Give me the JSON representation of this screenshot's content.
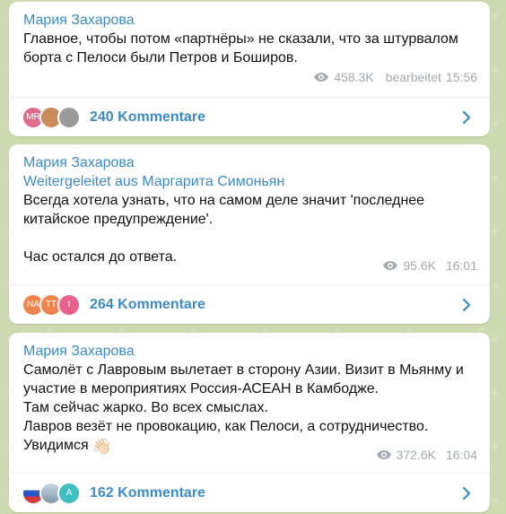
{
  "posts": [
    {
      "author": "Мария Захарова",
      "text": "Главное, чтобы потом «партнёры» не сказали, что за штурвалом борта с Пелоси были Петров и Боширов.",
      "views": "458.3K",
      "edited": "bearbeitet",
      "time": "15:56",
      "comments_label": "240 Kommentare",
      "avatars": [
        {
          "label": "MR",
          "color": "#e06b8b"
        },
        {
          "label": "",
          "color": "#c98b5a"
        },
        {
          "label": "",
          "color": "#9a9a9a"
        }
      ]
    },
    {
      "author": "Мария Захарова",
      "forwarded": "Weitergeleitet aus Маргарита Симоньян",
      "text": "Всегда хотела узнать, что на самом деле значит 'последнее китайское предупреждение'.\n\nЧас остался до ответа.",
      "views": "95.6K",
      "time": "16:01",
      "comments_label": "264 Kommentare",
      "avatars": [
        {
          "label": "NA",
          "color": "#f0844c"
        },
        {
          "label": "TT",
          "color": "#f0844c"
        },
        {
          "label": "I",
          "color": "#e8608c"
        }
      ]
    },
    {
      "author": "Мария Захарова",
      "text": "Самолёт с Лавровым вылетает в сторону Азии. Визит в Мьянму и участие в мероприятиях Россия-АСЕАН в Камбодже.\nТам сейчас жарко. Во всех смыслах.\nЛавров везёт не провокацию, как Пелоси, а сотрудничество.\nУвидимся",
      "emoji": "👋🏻",
      "views": "372.6K",
      "time": "16:04",
      "comments_label": "162 Kommentare",
      "avatars": [
        {
          "label": "",
          "color": "#d63a3a"
        },
        {
          "label": "",
          "color": "#8fa6b8"
        },
        {
          "label": "A",
          "color": "#3fbfc0"
        }
      ]
    }
  ],
  "colors": {
    "accent": "#3a8bc7",
    "meta": "#a3aab0",
    "background": "#cdd9b0"
  },
  "icons": {
    "views": "eye-icon",
    "open": "chevron-right-icon"
  }
}
